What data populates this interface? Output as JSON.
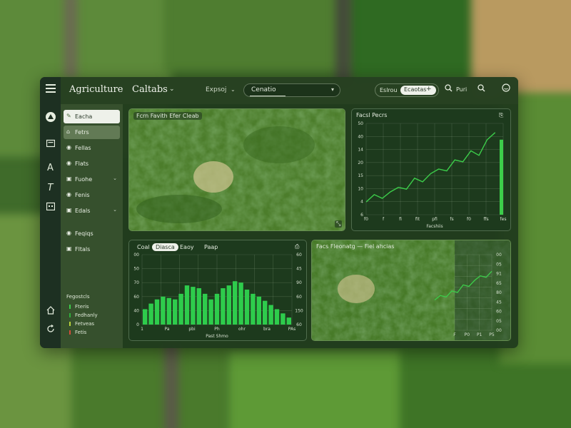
{
  "app": {
    "name": "Agriculture",
    "menu_icon": "hamburger-icon"
  },
  "topbar": {
    "section_title": "Caltabs",
    "search_label": "Expsoj",
    "search_value": "Cenatio",
    "filter_label": "Eslrou",
    "filter_pill": "Ecaotas",
    "run_label": "Puri"
  },
  "rail_icons": [
    "leaf-icon",
    "document-icon",
    "text-icon",
    "font-icon",
    "calendar-icon",
    "home-icon",
    "refresh-icon"
  ],
  "sidebar": {
    "items": [
      {
        "label": "Eacha",
        "icon": "tag-icon",
        "active": true
      },
      {
        "label": "Fetrs",
        "icon": "user-icon"
      },
      {
        "label": "Fellas",
        "icon": "pin-icon"
      },
      {
        "label": "Flats",
        "icon": "pin-icon"
      },
      {
        "label": "Fuohe",
        "icon": "file-icon",
        "chevron": true
      },
      {
        "label": "Fenis",
        "icon": "pin-icon"
      },
      {
        "label": "Edals",
        "icon": "file-icon",
        "chevron": true
      },
      {
        "label": "Feqiqs",
        "icon": "pin-icon"
      },
      {
        "label": "Fltals",
        "icon": "file-icon"
      }
    ],
    "legend": {
      "title": "Fegostcls",
      "items": [
        {
          "label": "Fteris",
          "color": "#3ccd4a"
        },
        {
          "label": "Fedhanly",
          "color": "#2fae3c"
        },
        {
          "label": "Fetveas",
          "color": "#b9d23a"
        },
        {
          "label": "Fetis",
          "color": "#d64b3a"
        }
      ]
    }
  },
  "map_panel": {
    "title": "Fcrn  Favith Efer Cleab",
    "corner_icon": "expand-icon"
  },
  "chart_data": [
    {
      "type": "line",
      "title": "Facsl Pecrs",
      "xlabel": "Facshiis",
      "x_ticks": [
        "f0",
        "f",
        "fi",
        "fit",
        "pfi",
        "fs",
        "f0",
        "ffs",
        "fes"
      ],
      "y_ticks": [
        "6",
        "4",
        "10",
        "15",
        "20",
        "14",
        "40",
        "50"
      ],
      "y": [
        14,
        22,
        18,
        25,
        30,
        28,
        40,
        36,
        45,
        50,
        48,
        60,
        58,
        70,
        65,
        82,
        90,
        10
      ],
      "ylim": [
        0,
        100
      ],
      "grid": true,
      "color": "#3ccd4a",
      "corner_icon": "export-icon"
    },
    {
      "type": "bar",
      "tabs": [
        "Coal",
        "Diasca",
        "Eaoy",
        "Paap"
      ],
      "active_tab": 1,
      "xlabel": "Past Shmo",
      "x_ticks": [
        "1",
        "Pa",
        "pbi",
        "Ph",
        "ohr",
        "bra",
        "PAs"
      ],
      "y_ticks_left": [
        "00",
        "50",
        "70",
        "60",
        "40",
        "0"
      ],
      "y_ticks_right": [
        "60",
        "45",
        "90",
        "60",
        "150",
        "60"
      ],
      "values": [
        22,
        30,
        36,
        40,
        38,
        36,
        44,
        56,
        54,
        52,
        44,
        36,
        44,
        52,
        56,
        62,
        60,
        50,
        44,
        40,
        34,
        28,
        22,
        16,
        10
      ],
      "ylim": [
        0,
        100
      ],
      "grid": true,
      "color": "#2ecc4c",
      "corner_icon": "clipboard-icon"
    },
    {
      "type": "line",
      "title": "Facs Fleonatg — Fiel ahcias",
      "x_ticks": [
        "F",
        "P0",
        "P1",
        "P5"
      ],
      "y_ticks": [
        "00",
        "05",
        "91",
        "65",
        "80",
        "45",
        "60",
        "05",
        "00"
      ],
      "y": [
        40,
        46,
        44,
        52,
        50,
        60,
        58,
        66,
        72,
        70,
        78
      ],
      "ylim": [
        0,
        100
      ],
      "grid": true,
      "color": "#3ccd4a"
    }
  ]
}
